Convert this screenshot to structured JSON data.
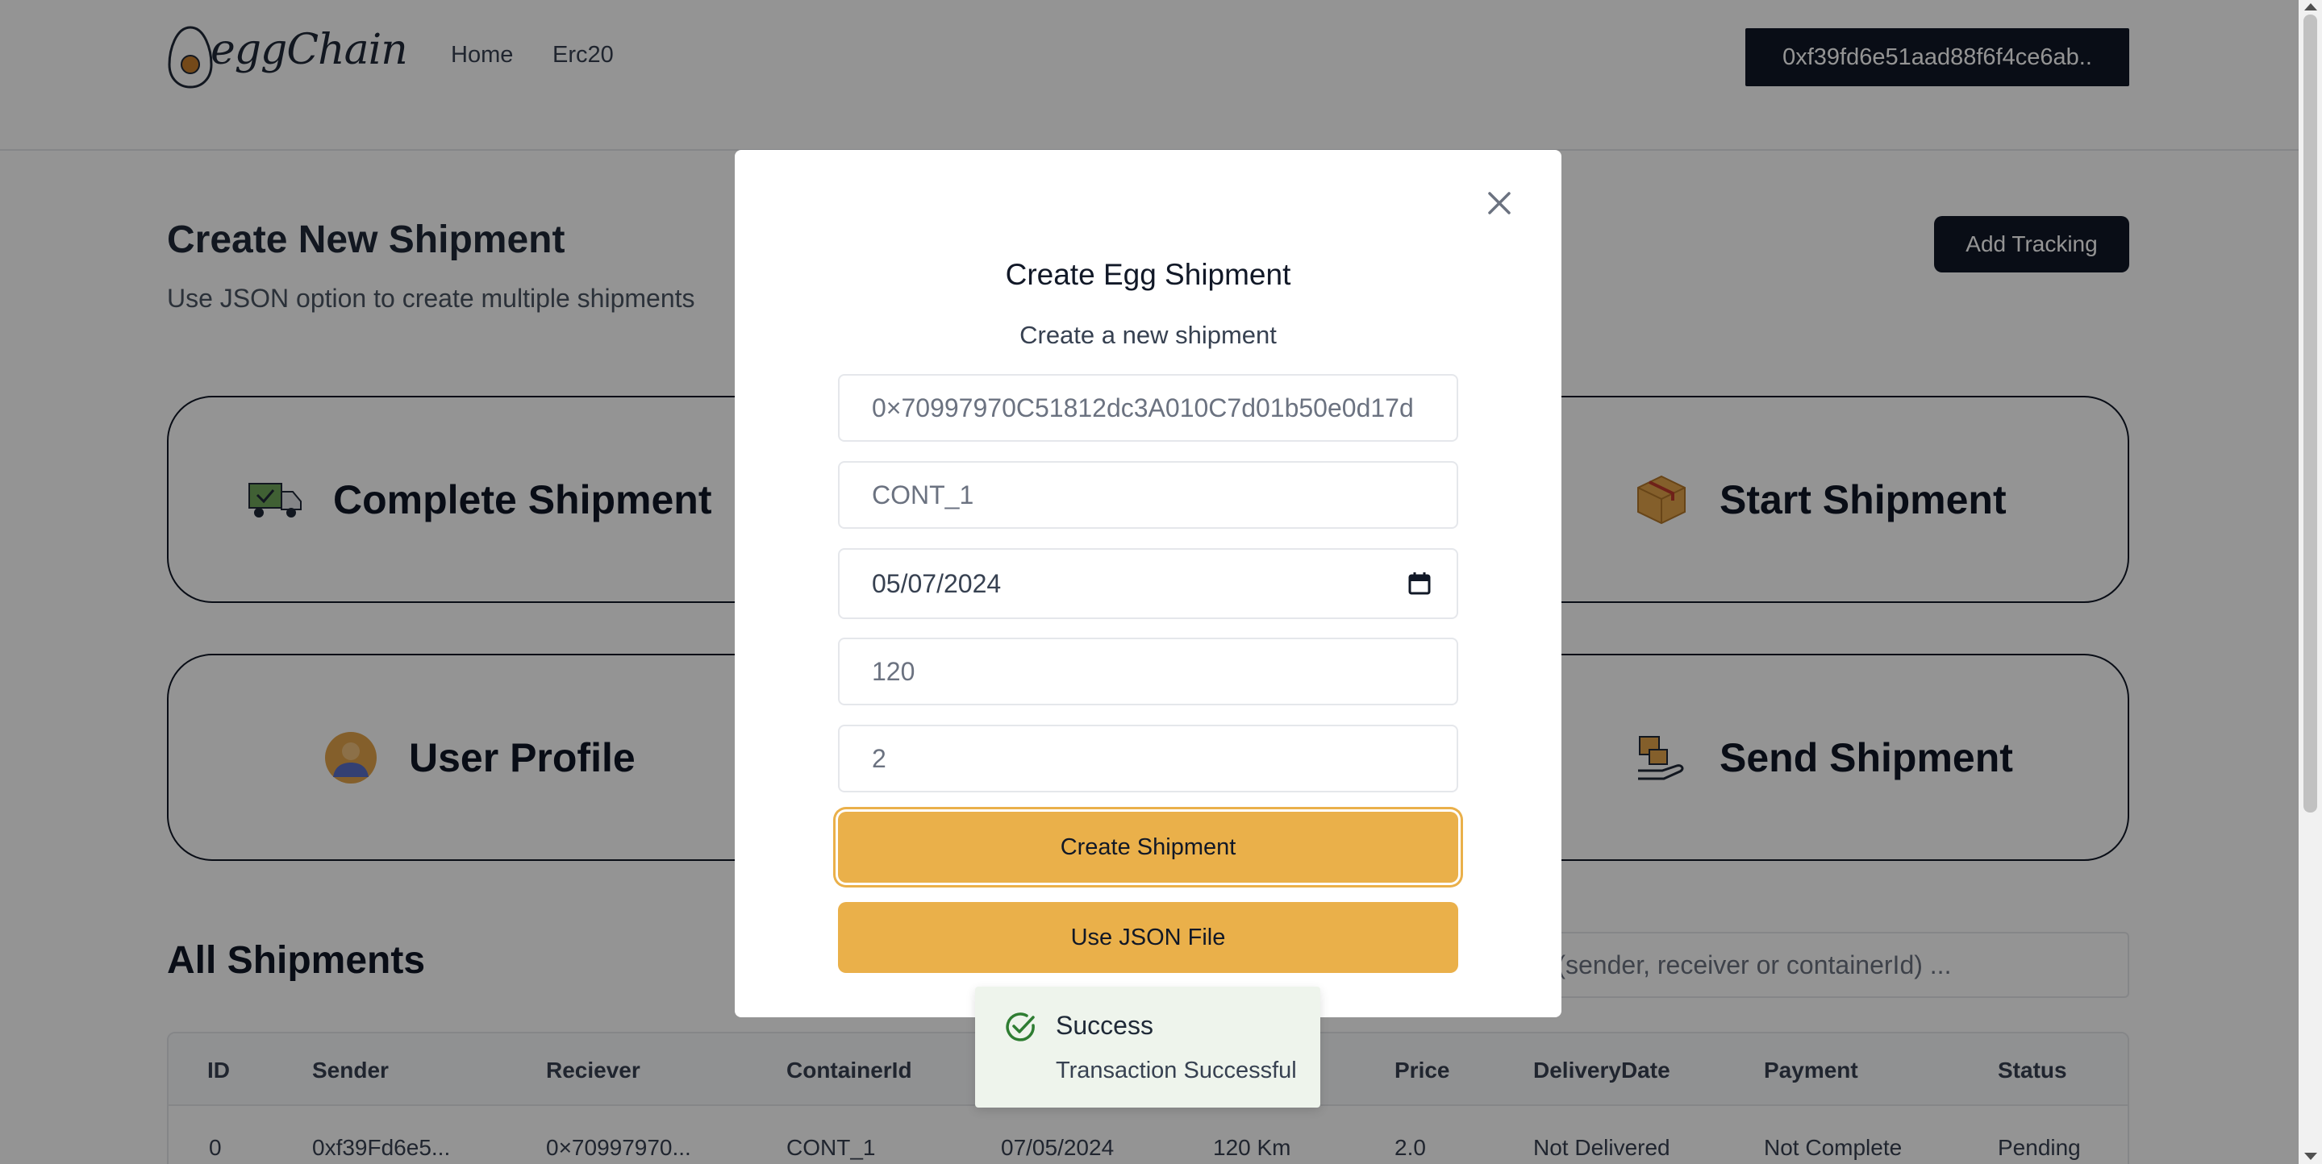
{
  "navbar": {
    "brand": "eggChain",
    "links": [
      "Home",
      "Erc20"
    ],
    "wallet_address": "0xf39fd6e51aad88f6f4ce6ab.."
  },
  "header": {
    "title": "Create New Shipment",
    "subtitle": "Use JSON option to create multiple shipments",
    "add_tracking_label": "Add Tracking"
  },
  "cards": [
    {
      "label": "Complete Shipment",
      "icon": "delivery-truck-icon"
    },
    {
      "label": "Start Shipment",
      "icon": "package-box-icon"
    },
    {
      "label": "User Profile",
      "icon": "user-avatar-icon"
    },
    {
      "label": "Send Shipment",
      "icon": "hand-package-icon"
    }
  ],
  "shipments": {
    "title": "All Shipments",
    "search_placeholder": "ers (sender, receiver or containerId) ...",
    "columns": [
      "ID",
      "Sender",
      "Reciever",
      "ContainerId",
      "",
      "",
      "Price",
      "DeliveryDate",
      "Payment",
      "Status"
    ],
    "rows": [
      [
        "0",
        "0xf39Fd6e5...",
        "0×70997970...",
        "CONT_1",
        "07/05/2024",
        "120 Km",
        "2.0",
        "Not Delivered",
        "Not Complete",
        "Pending"
      ]
    ]
  },
  "modal": {
    "title": "Create Egg Shipment",
    "subtitle": "Create a new shipment",
    "receiver_value": "0×70997970C51812dc3A010C7d01b50e0d17d",
    "container_value": "CONT_1",
    "date_value": "05/07/2024",
    "distance_value": "120",
    "price_value": "2",
    "create_label": "Create Shipment",
    "json_label": "Use JSON File"
  },
  "toast": {
    "title": "Success",
    "message": "Transaction Successful"
  },
  "colors": {
    "accent": "#eab04a",
    "dark": "#111827",
    "success": "#2e7d32"
  }
}
